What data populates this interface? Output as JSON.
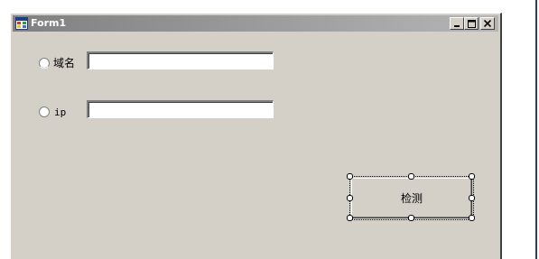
{
  "window": {
    "title": "Form1",
    "icon": "form-app-icon",
    "controls": [
      "minimize-icon",
      "maximize-icon",
      "close-icon"
    ]
  },
  "form": {
    "radio_domain": {
      "label": "域名",
      "checked": false
    },
    "input_domain": {
      "value": "",
      "placeholder": ""
    },
    "radio_ip": {
      "label": "ip",
      "checked": false
    },
    "input_ip": {
      "value": "",
      "placeholder": ""
    },
    "detect_button": {
      "label": "检测",
      "selected_in_designer": true
    }
  },
  "colors": {
    "form_background": "#d4d0c8",
    "titlebar_start": "#808080",
    "titlebar_end": "#b5b5b5",
    "designer_edge": "#2b3e63"
  }
}
